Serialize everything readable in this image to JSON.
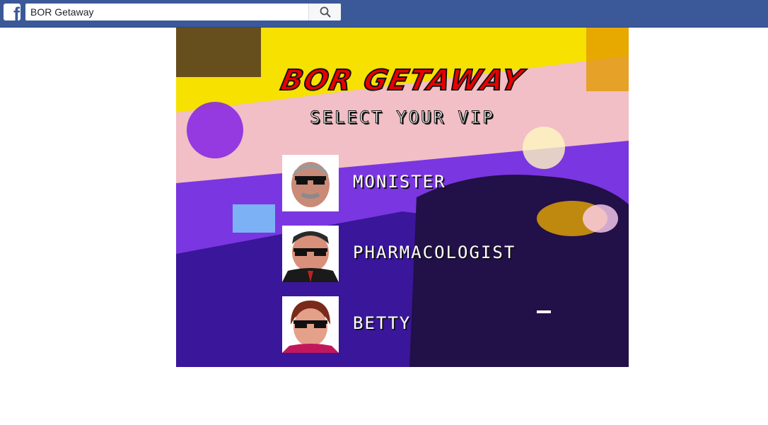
{
  "topbar": {
    "logo_icon": "facebook-logo-icon",
    "search": {
      "value": "BOR Getaway",
      "placeholder": "Search",
      "button_icon": "search-icon"
    },
    "colors": {
      "brand": "#3b5998"
    }
  },
  "game": {
    "title": "BOR GETAWAY",
    "subtitle": "SELECT YOUR VIP",
    "vips": [
      {
        "name": "MONISTER"
      },
      {
        "name": "PHARMACOLOGIST"
      },
      {
        "name": "BETTY"
      }
    ],
    "colors": {
      "title_red": "#e80000",
      "sky_yellow": "#f7e60b",
      "purple": "#6a2cd6"
    }
  }
}
